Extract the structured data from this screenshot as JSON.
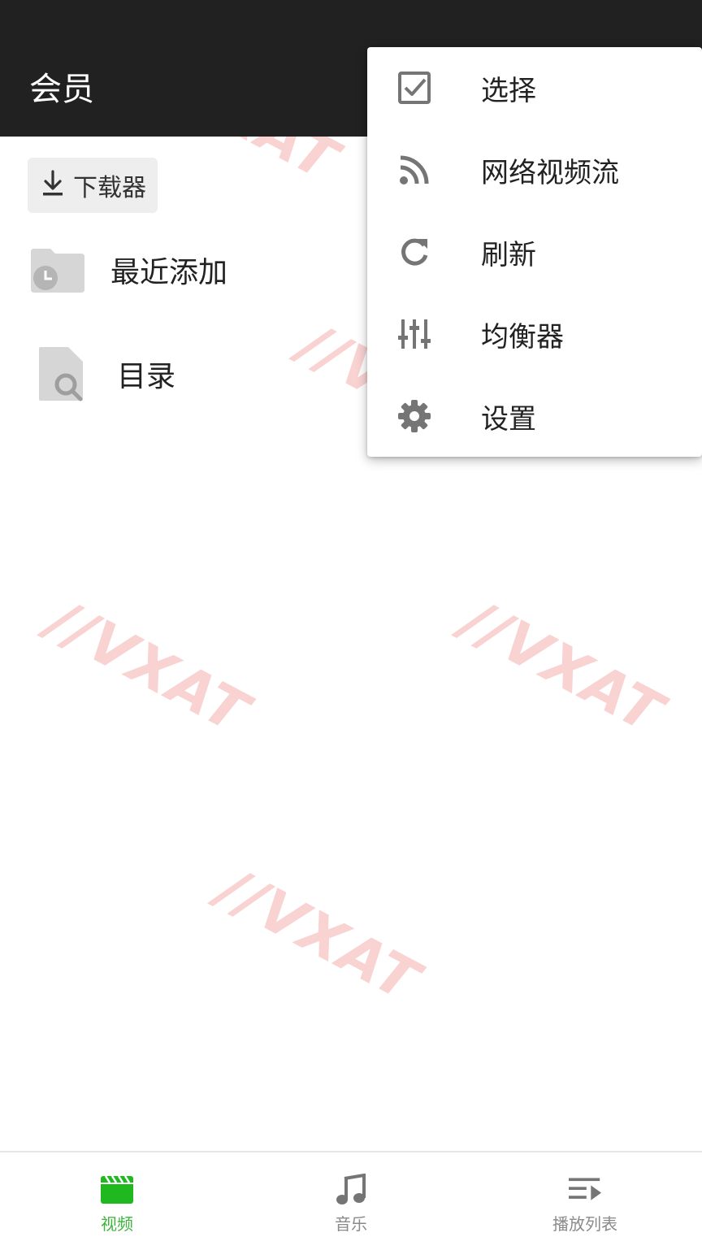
{
  "appbar": {
    "title": "会员"
  },
  "toolbar": {
    "downloader_label": "下载器"
  },
  "list": {
    "items": [
      {
        "label": "最近添加",
        "icon": "folder-clock-icon"
      },
      {
        "label": "目录",
        "icon": "file-search-icon"
      }
    ]
  },
  "menu": {
    "items": [
      {
        "label": "选择",
        "icon": "checkbox-icon"
      },
      {
        "label": "网络视频流",
        "icon": "rss-icon"
      },
      {
        "label": "刷新",
        "icon": "refresh-icon"
      },
      {
        "label": "均衡器",
        "icon": "equalizer-icon"
      },
      {
        "label": "设置",
        "icon": "gear-icon"
      }
    ]
  },
  "bottom_nav": {
    "items": [
      {
        "label": "视频",
        "icon": "video-clapper-icon",
        "active": true
      },
      {
        "label": "音乐",
        "icon": "music-note-icon",
        "active": false
      },
      {
        "label": "播放列表",
        "icon": "playlist-icon",
        "active": false
      }
    ]
  },
  "colors": {
    "appbar": "#212121",
    "accent_green": "#3cb33c",
    "icon_gray": "#757575",
    "watermark_red": "#e53935"
  }
}
